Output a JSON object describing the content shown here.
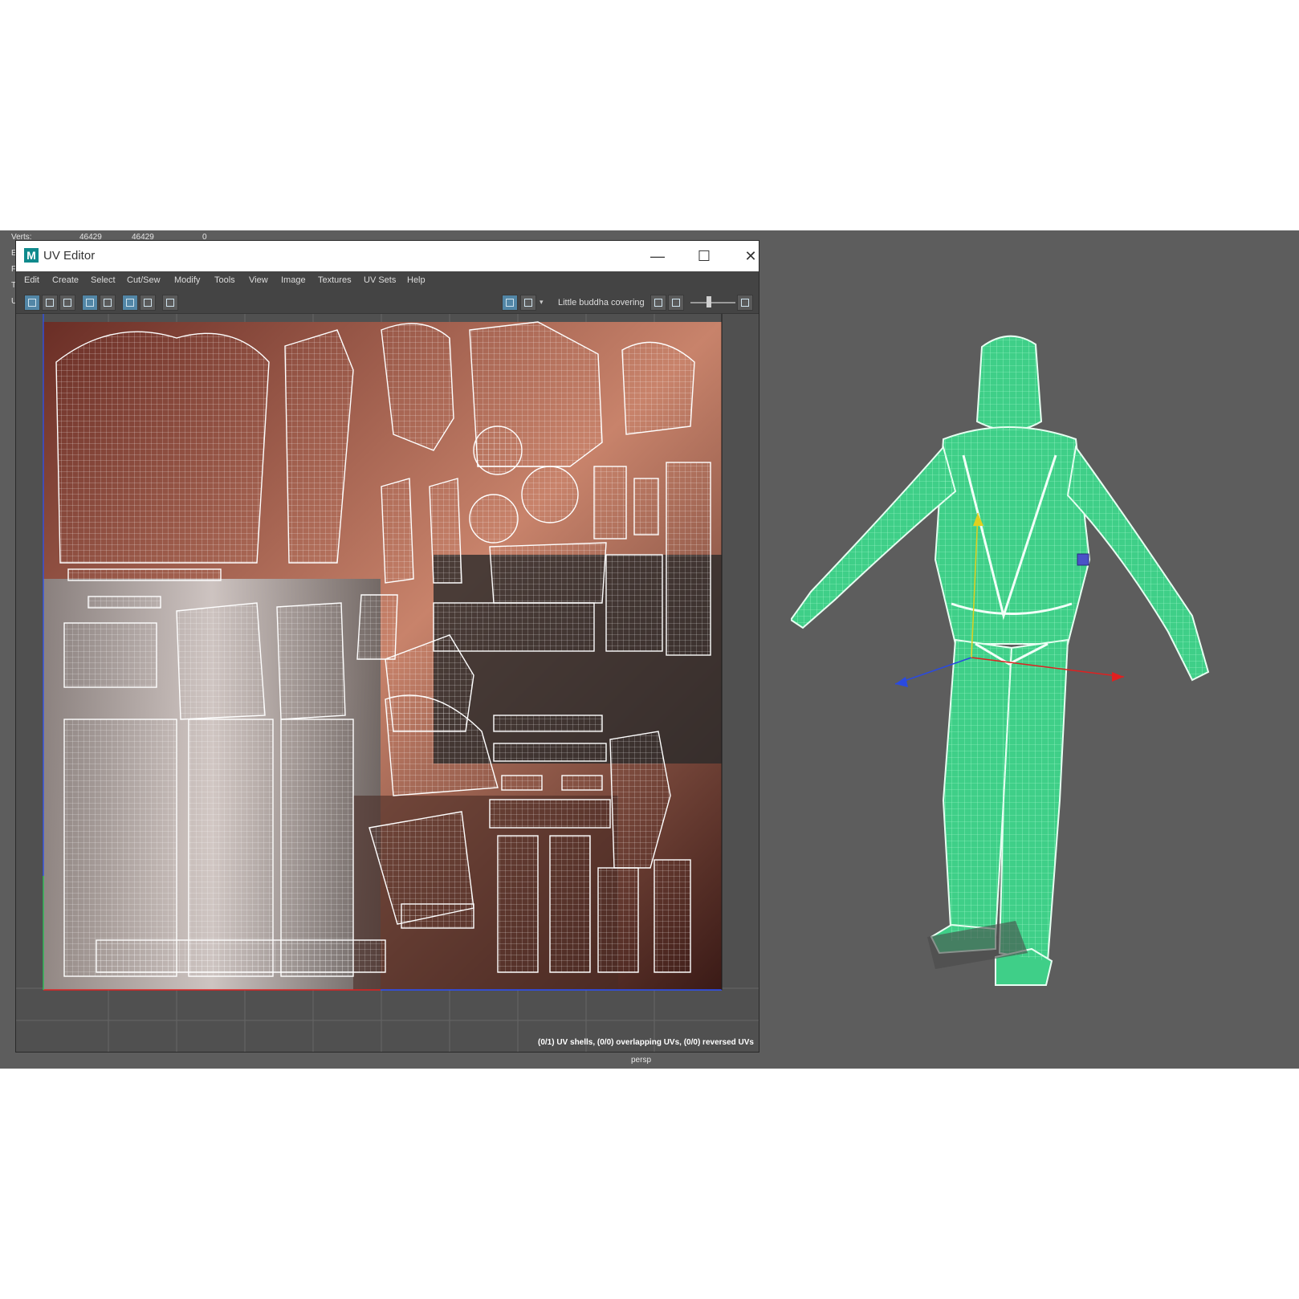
{
  "stats": {
    "rows": [
      {
        "label": "Verts:",
        "v1": "46429",
        "v2": "46429",
        "v3": "0"
      },
      {
        "label": "E",
        "v1": "",
        "v2": "",
        "v3": ""
      },
      {
        "label": "F",
        "v1": "",
        "v2": "",
        "v3": ""
      },
      {
        "label": "T",
        "v1": "",
        "v2": "",
        "v3": ""
      },
      {
        "label": "U",
        "v1": "",
        "v2": "",
        "v3": ""
      }
    ]
  },
  "uv_editor": {
    "title": "UV Editor",
    "logo": "M",
    "menu": [
      "Edit",
      "Create",
      "Select",
      "Cut/Sew",
      "Modify",
      "Tools",
      "View",
      "Image",
      "Textures",
      "UV Sets",
      "Help"
    ],
    "texture_name": "Little buddha covering",
    "status_text": "(0/1) UV shells, (0/0) overlapping UVs, (0/0) reversed UVs"
  },
  "viewport": {
    "camera_label": "persp"
  },
  "colors": {
    "wireframe": "#4de89a",
    "viewport_bg": "#5d5d5d",
    "accent": "#5286a6"
  }
}
